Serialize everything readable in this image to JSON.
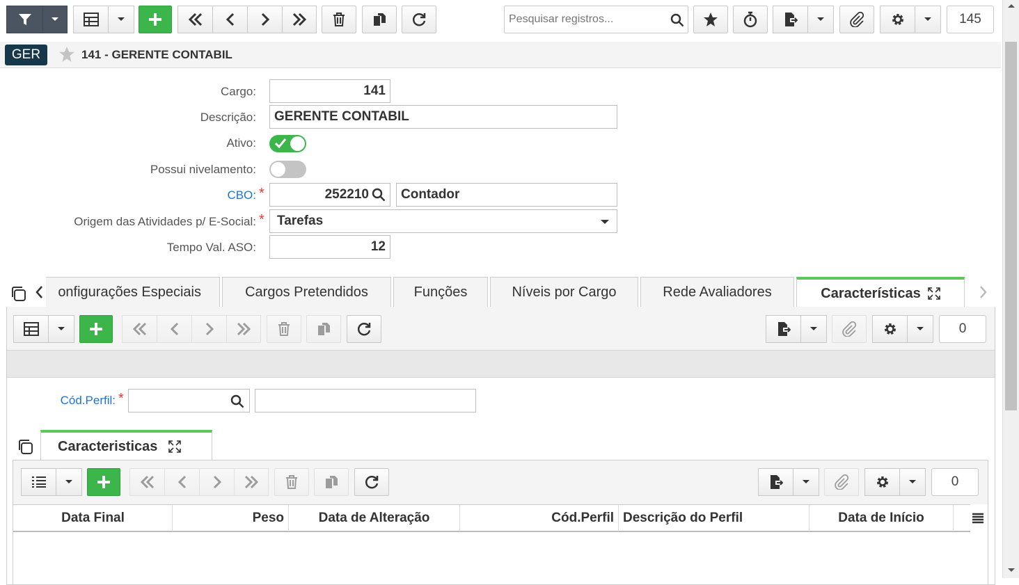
{
  "toolbar": {
    "search_placeholder": "Pesquisar registros...",
    "record_count": "145"
  },
  "header": {
    "badge": "GER",
    "title": "141 - GERENTE CONTABIL"
  },
  "form": {
    "cargo_label": "Cargo:",
    "cargo_value": "141",
    "descricao_label": "Descrição:",
    "descricao_value": "GERENTE CONTABIL",
    "ativo_label": "Ativo:",
    "ativo_on": true,
    "nivelamento_label": "Possui nivelamento:",
    "nivelamento_on": false,
    "cbo_label": "CBO:",
    "cbo_code": "252210",
    "cbo_desc": "Contador",
    "origem_label": "Origem das Atividades p/ E-Social:",
    "origem_value": "Tarefas",
    "tempo_label": "Tempo Val. ASO:",
    "tempo_value": "12"
  },
  "tabs": [
    {
      "label": "onfigurações Especiais"
    },
    {
      "label": "Cargos Pretendidos"
    },
    {
      "label": "Funções"
    },
    {
      "label": "Níveis por Cargo"
    },
    {
      "label": "Rede Avaliadores"
    },
    {
      "label": "Características",
      "active": true
    }
  ],
  "sub": {
    "record_count": "0",
    "perfil_label": "Cód.Perfil:",
    "inner_tab": "Caracteristicas",
    "grid_count": "0",
    "columns": [
      "Data Final",
      "Peso",
      "Data de Alteração",
      "Cód.Perfil",
      "Descrição do Perfil",
      "Data de Início"
    ]
  },
  "colors": {
    "accent_green": "#3cb54a",
    "link_blue": "#1e73d4",
    "required_red": "#e53935",
    "tab_active": "#5cc85c"
  }
}
